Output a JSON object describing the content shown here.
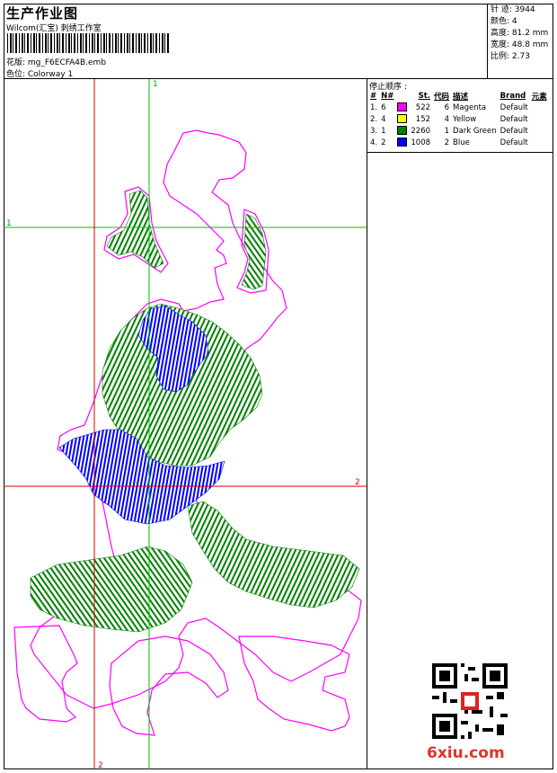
{
  "header": {
    "title": "生产作业图",
    "company": "Wilcom(汇宝) 刺绣工作室",
    "design_label": "花版: mg_F6ECFA4B.emb",
    "colorway_label": "色位: Colorway 1"
  },
  "specs": {
    "stitches": "针 迹: 3944",
    "colors": "颜色: 4",
    "height": "高度: 81.2 mm",
    "width": "宽度: 48.8 mm",
    "scale": "比例: 2.73"
  },
  "stop_sequence": {
    "title": "停止顺序 :",
    "columns": [
      "#",
      "N#",
      "St.",
      "代码",
      "描述",
      "Brand",
      "元素"
    ],
    "rows": [
      {
        "n": "1.",
        "nn": "6",
        "color": "#ff00ff",
        "st": "522",
        "code": "6",
        "desc": "Magenta",
        "brand": "Default"
      },
      {
        "n": "2.",
        "nn": "4",
        "color": "#ffff00",
        "st": "152",
        "code": "4",
        "desc": "Yellow",
        "brand": "Default"
      },
      {
        "n": "3.",
        "nn": "1",
        "color": "#008000",
        "st": "2260",
        "code": "1",
        "desc": "Dark Green",
        "brand": "Default"
      },
      {
        "n": "4.",
        "nn": "2",
        "color": "#0000ff",
        "st": "1008",
        "code": "2",
        "desc": "Blue",
        "brand": "Default"
      }
    ]
  },
  "guides": {
    "green_vertical_label": "1",
    "green_horizontal_label": "1",
    "red_horizontal_label": "2",
    "red_vertical_label": "2"
  },
  "watermark": "6xiu.com",
  "colors": {
    "outline": "#ff00ff",
    "fill_green": "#008000",
    "fill_blue": "#0000ff",
    "guide_green": "#00c000",
    "guide_red": "#d00000",
    "watermark": "#e2322a"
  }
}
